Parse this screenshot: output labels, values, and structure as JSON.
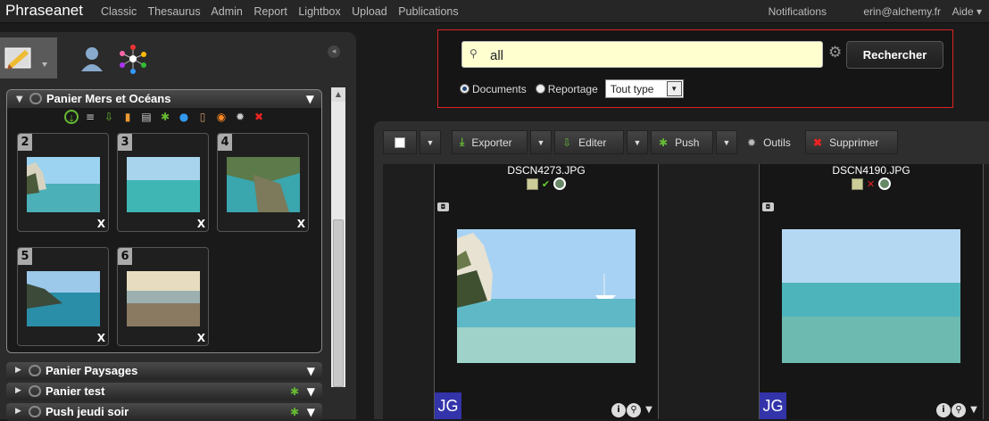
{
  "app": {
    "logo": "Phraseanet"
  },
  "menu": [
    "Classic",
    "Thesaurus",
    "Admin",
    "Report",
    "Lightbox",
    "Upload",
    "Publications"
  ],
  "topright": {
    "notifications": "Notifications",
    "user": "erin@alchemy.fr",
    "help": "Aide"
  },
  "sidebar": {
    "open_basket": {
      "title": "Panier Mers et Océans",
      "items": [
        {
          "num": "2",
          "remove": "X"
        },
        {
          "num": "3",
          "remove": "X"
        },
        {
          "num": "4",
          "remove": "X"
        },
        {
          "num": "5",
          "remove": "X"
        },
        {
          "num": "6",
          "remove": "X"
        }
      ]
    },
    "baskets": [
      {
        "title": "Panier Paysages"
      },
      {
        "title": "Panier test"
      },
      {
        "title": "Push jeudi soir"
      }
    ]
  },
  "search": {
    "query": "all",
    "button": "Rechercher",
    "opt_documents": "Documents",
    "opt_reportage": "Reportage",
    "type_selected": "Tout type"
  },
  "toolbar": {
    "export": "Exporter",
    "edit": "Editer",
    "push": "Push",
    "tools": "Outils",
    "delete": "Supprimer"
  },
  "results": [
    {
      "filename": "DSCN4273.JPG",
      "badge": "JG"
    },
    {
      "filename": "DSCN4190.JPG",
      "badge": "JG"
    }
  ],
  "colors": {
    "accent_border": "#dd2222",
    "badge_bg": "#3333aa",
    "search_bg": "#ffffd0"
  }
}
